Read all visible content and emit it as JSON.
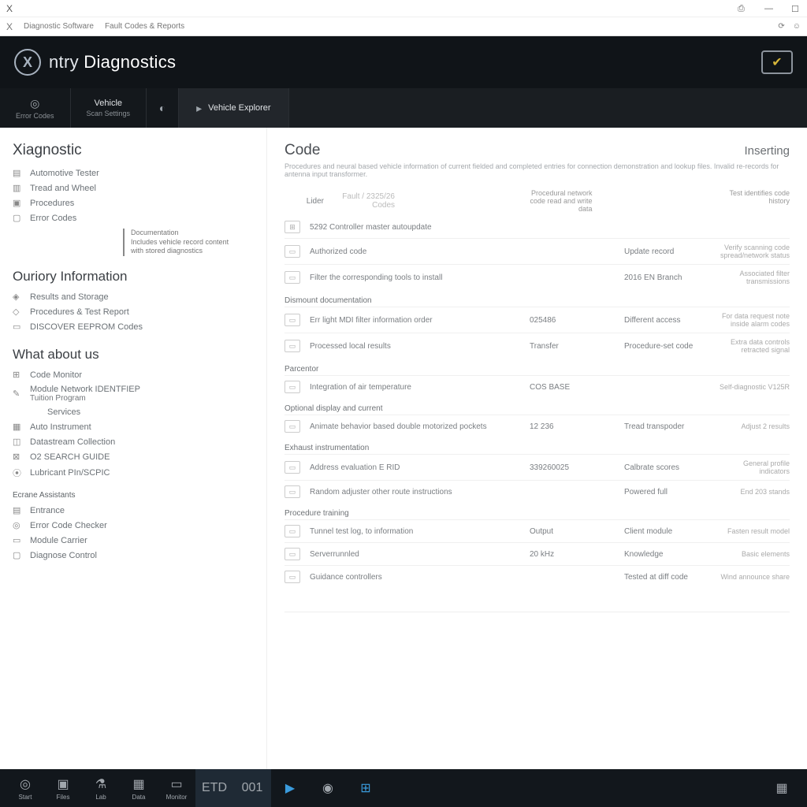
{
  "titlebar": {
    "close_x": "X"
  },
  "metabar": {
    "close_x": "X",
    "crumb1": "Diagnostic Software",
    "crumb2": "Fault Codes & Reports"
  },
  "header": {
    "brand_prefix": "ntry ",
    "brand_main": "Diagnostics",
    "logo_letter": "X"
  },
  "ribbon": [
    {
      "icon": "◎",
      "top": "",
      "bot": "Error Codes"
    },
    {
      "icon": "",
      "top": "Vehicle",
      "bot": "Scan Settings"
    },
    {
      "icon": "◐",
      "top": "",
      "bot": ""
    },
    {
      "icon": "▸",
      "top": "Vehicle Explorer",
      "bot": ""
    }
  ],
  "sidebar": {
    "title": "Xiagnostic",
    "sec1": [
      {
        "icon": "▤",
        "label": "Automotive Tester"
      },
      {
        "icon": "▥",
        "label": "Tread and Wheel"
      },
      {
        "icon": "▣",
        "label": "Procedures"
      },
      {
        "icon": "▢",
        "label": "Error Codes"
      }
    ],
    "callout": {
      "t": "Documentation",
      "l1": "Includes vehicle record content",
      "l2": "with stored diagnostics"
    },
    "sec2_title": "Ouriory Information",
    "sec2": [
      {
        "icon": "◈",
        "label": "Results and Storage"
      },
      {
        "icon": "◇",
        "label": "Procedures & Test Report"
      },
      {
        "icon": "▭",
        "label": "DISCOVER EEPROM Codes"
      }
    ],
    "sec3_title": "What about us",
    "sec3": [
      {
        "icon": "⊞",
        "label": "Code Monitor"
      },
      {
        "icon": "✎",
        "label": "Module Network IDENTFIEP",
        "sub": "Tuition Program"
      },
      {
        "icon": "",
        "label": "Services",
        "indent": true
      },
      {
        "icon": "▦",
        "label": "Auto Instrument"
      },
      {
        "icon": "◫",
        "label": "Datastream Collection"
      },
      {
        "icon": "⊠",
        "label": "O2 SEARCH GUIDE"
      },
      {
        "icon": "⦿",
        "label": "Lubricant PIn/SCPIC"
      }
    ],
    "sec4_title": "Ecrane Assistants",
    "sec4": [
      {
        "icon": "▤",
        "label": "Entrance"
      },
      {
        "icon": "◎",
        "label": "Error Code Checker"
      },
      {
        "icon": "▭",
        "label": "Module Carrier"
      },
      {
        "icon": "▢",
        "label": "Diagnose Control"
      }
    ]
  },
  "content": {
    "title": "Code",
    "status": "Inserting",
    "desc": "Procedures and neural based vehicle information of current fielded and completed entries for connection demonstration and lookup files. Invalid re-records for antenna input transformer.",
    "lister_label": "Lider",
    "lister_value": "Fault / 2325/26 Codes",
    "top_hdr1": "Procedural network code read and write data",
    "top_hdr2": "Test identifies code history",
    "filter_row": {
      "icon": "⊞",
      "text": "5292 Controller master autoupdate"
    },
    "groups": [
      {
        "rows": [
          {
            "c1": "Authorized code",
            "c2": "",
            "c3": "Update record",
            "c4": "Verify scanning code spread/network status"
          },
          {
            "c1": "Filter the corresponding tools to install",
            "c2": "",
            "c3": "2016 EN Branch",
            "c4": "Associated filter transmissions"
          }
        ]
      },
      {
        "head": "Dismount documentation",
        "rows": [
          {
            "c1": "Err light MDI filter information order",
            "c2": "025486",
            "c3": "Different access",
            "c4": "For data request note inside alarm codes"
          },
          {
            "c1": "Processed local results",
            "c2": "Transfer",
            "c3": "Procedure-set code",
            "c4": "Extra data controls retracted signal"
          }
        ]
      },
      {
        "head": "Parcentor",
        "rows": [
          {
            "c1": "Integration of air temperature",
            "c2": "COS BASE",
            "c3": "",
            "c4": "Self-diagnostic V125R"
          }
        ]
      },
      {
        "head": "Optional display and current",
        "rows": [
          {
            "c1": "Animate behavior based double motorized pockets",
            "c2": "12 236",
            "c3": "Tread transpoder",
            "c4": "Adjust 2 results"
          }
        ]
      },
      {
        "head": "Exhaust instrumentation",
        "rows": [
          {
            "c1": "Address evaluation E RID",
            "c2": "339260025",
            "c3": "Calbrate scores",
            "c4": "General profile indicators"
          },
          {
            "c1": "Random adjuster other route instructions",
            "c2": "",
            "c3": "Powered full",
            "c4": "End 203 stands"
          }
        ]
      },
      {
        "head": "Procedure training",
        "rows": [
          {
            "c1": "Tunnel test log, to information",
            "c2": "Output",
            "c3": "Client module",
            "c4": "Fasten result model"
          },
          {
            "c1": "Serverrunnled",
            "c2": "20 kHz",
            "c3": "Knowledge",
            "c4": "Basic elements"
          },
          {
            "c1": "Guidance controllers",
            "c2": "",
            "c3": "Tested at diff code",
            "c4": "Wind announce share"
          }
        ]
      }
    ]
  },
  "taskbar": [
    {
      "icon": "◎",
      "label": "Start"
    },
    {
      "icon": "▣",
      "label": "Files"
    },
    {
      "icon": "⚗",
      "label": "Lab"
    },
    {
      "icon": "▦",
      "label": "Data"
    },
    {
      "icon": "▭",
      "label": "Monitor"
    },
    {
      "icon": "ETD",
      "label": ""
    },
    {
      "icon": "001",
      "label": ""
    },
    {
      "icon": "▶",
      "label": "",
      "blue": true
    },
    {
      "icon": "◉",
      "label": ""
    },
    {
      "icon": "⊞",
      "label": "",
      "blue": true
    }
  ]
}
